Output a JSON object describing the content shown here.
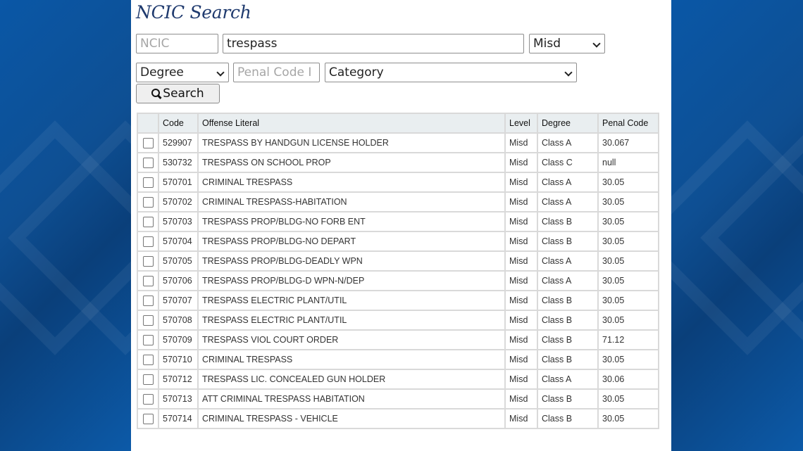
{
  "title": "NCIC Search",
  "form": {
    "ncic_placeholder": "NCIC",
    "search_value": "trespass",
    "level_selected": "Misd",
    "degree_selected": "Degree",
    "penal_code_placeholder": "Penal Code I",
    "category_selected": "Category",
    "search_button": "Search"
  },
  "table": {
    "headers": [
      "",
      "Code",
      "Offense Literal",
      "Level",
      "Degree",
      "Penal Code"
    ],
    "rows": [
      [
        "529907",
        "TRESPASS BY HANDGUN LICENSE HOLDER",
        "Misd",
        "Class A",
        "30.067"
      ],
      [
        "530732",
        "TRESPASS ON SCHOOL PROP",
        "Misd",
        "Class C",
        "null"
      ],
      [
        "570701",
        "CRIMINAL TRESPASS",
        "Misd",
        "Class A",
        "30.05"
      ],
      [
        "570702",
        "CRIMINAL TRESPASS-HABITATION",
        "Misd",
        "Class A",
        "30.05"
      ],
      [
        "570703",
        "TRESPASS PROP/BLDG-NO FORB ENT",
        "Misd",
        "Class B",
        "30.05"
      ],
      [
        "570704",
        "TRESPASS PROP/BLDG-NO DEPART",
        "Misd",
        "Class B",
        "30.05"
      ],
      [
        "570705",
        "TRESPASS PROP/BLDG-DEADLY WPN",
        "Misd",
        "Class A",
        "30.05"
      ],
      [
        "570706",
        "TRESPASS PROP/BLDG-D WPN-N/DEP",
        "Misd",
        "Class A",
        "30.05"
      ],
      [
        "570707",
        "TRESPASS ELECTRIC PLANT/UTIL",
        "Misd",
        "Class B",
        "30.05"
      ],
      [
        "570708",
        "TRESPASS ELECTRIC PLANT/UTIL",
        "Misd",
        "Class B",
        "30.05"
      ],
      [
        "570709",
        "TRESPASS VIOL COURT ORDER",
        "Misd",
        "Class B",
        "71.12"
      ],
      [
        "570710",
        "CRIMINAL TRESPASS",
        "Misd",
        "Class B",
        "30.05"
      ],
      [
        "570712",
        "TRESPASS LIC. CONCEALED GUN HOLDER",
        "Misd",
        "Class A",
        "30.06"
      ],
      [
        "570713",
        "ATT CRIMINAL TRESPASS HABITATION",
        "Misd",
        "Class B",
        "30.05"
      ],
      [
        "570714",
        "CRIMINAL TRESPASS - VEHICLE",
        "Misd",
        "Class B",
        "30.05"
      ]
    ]
  }
}
